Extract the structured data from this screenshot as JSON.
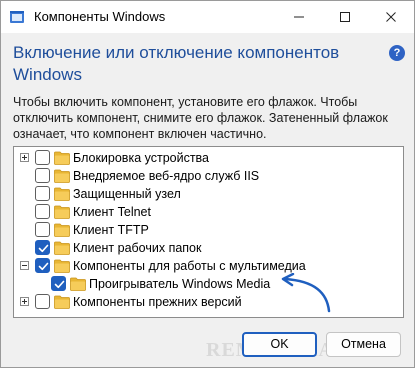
{
  "window": {
    "title": "Компоненты Windows",
    "heading": "Включение или отключение компонентов Windows",
    "description": "Чтобы включить компонент, установите его флажок. Чтобы отключить компонент, снимите его флажок. Затененный флажок означает, что компонент включен частично."
  },
  "colors": {
    "accent": "#1f5fbf",
    "heading": "#1f4e9b",
    "folder": "#e8b634",
    "arrow": "#1f5fbf"
  },
  "tree": {
    "items": [
      {
        "label": "Блокировка устройства",
        "checked": false,
        "expander": "plus",
        "level": 0
      },
      {
        "label": "Внедряемое веб-ядро служб IIS",
        "checked": false,
        "expander": null,
        "level": 0
      },
      {
        "label": "Защищенный узел",
        "checked": false,
        "expander": null,
        "level": 0
      },
      {
        "label": "Клиент Telnet",
        "checked": false,
        "expander": null,
        "level": 0
      },
      {
        "label": "Клиент TFTP",
        "checked": false,
        "expander": null,
        "level": 0
      },
      {
        "label": "Клиент рабочих папок",
        "checked": true,
        "expander": null,
        "level": 0
      },
      {
        "label": "Компоненты для работы с мультимедиа",
        "checked": true,
        "expander": "minus",
        "level": 0
      },
      {
        "label": "Проигрыватель Windows Media",
        "checked": true,
        "expander": null,
        "level": 1
      },
      {
        "label": "Компоненты прежних версий",
        "checked": false,
        "expander": "plus",
        "level": 0
      }
    ]
  },
  "buttons": {
    "ok": "OK",
    "cancel": "Отмена"
  },
  "watermark": "REMONTKA.COM",
  "icons": {
    "app": "windows-features-icon",
    "help": "help-icon",
    "folder": "folder-icon",
    "annotation": "curved-arrow-icon"
  },
  "help_glyph": "?"
}
